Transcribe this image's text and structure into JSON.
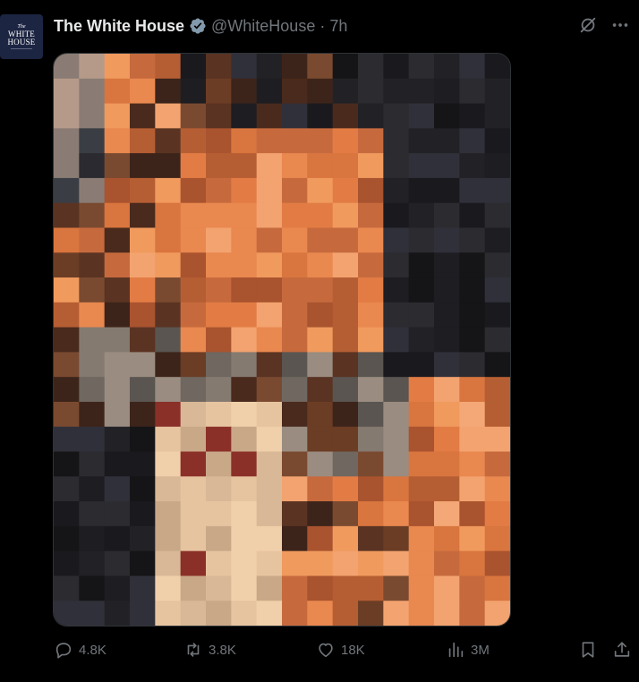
{
  "account": {
    "avatar_lines": [
      "The",
      "WHITE",
      "HOUSE"
    ],
    "name": "The White House",
    "handle": "@WhiteHouse",
    "separator": "·",
    "time": "7h"
  },
  "icons": {
    "verified": "verified-badge-icon",
    "grok": "grok-icon",
    "more": "more-icon",
    "reply": "reply-icon",
    "repost": "repost-icon",
    "like": "like-icon",
    "views": "views-icon",
    "bookmark": "bookmark-icon",
    "share": "share-icon"
  },
  "stats": {
    "replies": "4.8K",
    "reposts": "3.8K",
    "likes": "18K",
    "views": "3M"
  },
  "colors": {
    "background": "#000000",
    "text": "#e7e9ea",
    "muted": "#71767b",
    "verified": "#829aab"
  }
}
